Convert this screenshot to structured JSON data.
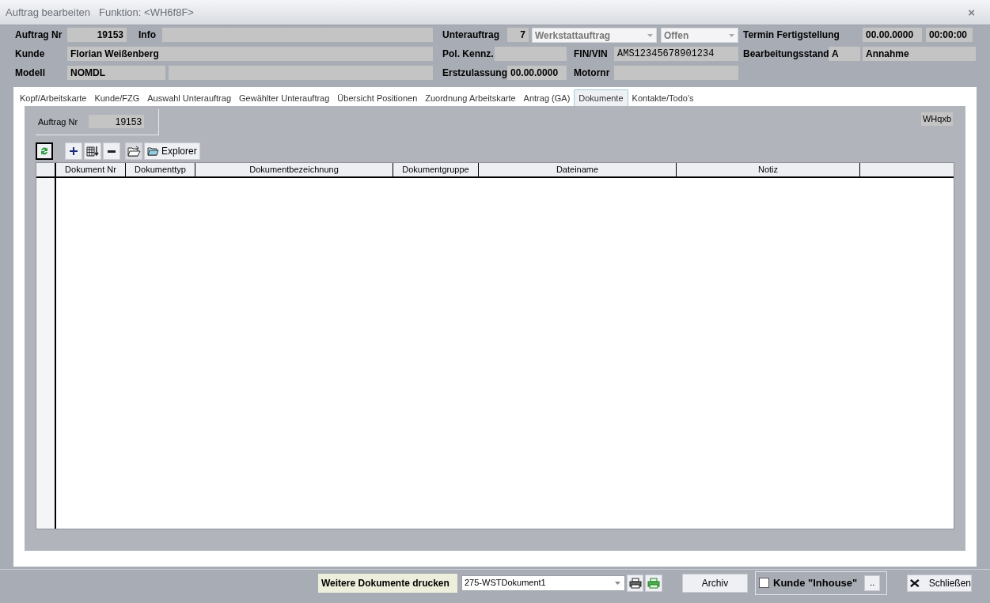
{
  "window": {
    "title": "Auftrag bearbeiten",
    "function": "Funktion: <WH6f8F>",
    "close": "×"
  },
  "header_fields": [
    {
      "label": "Auftrag Nr",
      "boxes": [
        {
          "kind": "number",
          "value": "19153"
        }
      ]
    },
    {
      "label": "Info",
      "boxes": [
        {
          "kind": "text"
        }
      ]
    },
    {
      "label": "Unterauftrag",
      "boxes": [
        {
          "kind": "number",
          "value": "7"
        },
        {
          "kind": "combo",
          "value": "Werkstattauftrag"
        },
        {
          "kind": "combo",
          "value": "Offen"
        }
      ]
    },
    {
      "label": "Termin Fertigstellung",
      "boxes": [
        {
          "kind": "text",
          "value": "00.00.0000"
        },
        {
          "kind": "text",
          "value": "00:00:00"
        }
      ]
    },
    {
      "label": "Kunde",
      "boxes": [
        {
          "kind": "text",
          "value": "Florian Weißenberg"
        }
      ]
    },
    {
      "label": "Pol. Kennz.",
      "boxes": [
        {
          "kind": "text"
        }
      ]
    },
    {
      "label": "FIN/VIN",
      "boxes": [
        {
          "kind": "code",
          "value": "AMS12345678901234"
        }
      ]
    },
    {
      "label": "Bearbeitungsstand",
      "boxes": [
        {
          "kind": "text",
          "value": "A"
        },
        {
          "kind": "text",
          "value": "Annahme"
        }
      ]
    },
    {
      "label": "Modell",
      "boxes": [
        {
          "kind": "text",
          "value": "NOMDL"
        },
        {
          "kind": "text"
        }
      ]
    },
    {
      "label": "Erstzulassung",
      "boxes": [
        {
          "kind": "text",
          "value": "00.00.0000"
        }
      ]
    },
    {
      "label": "Motornr",
      "boxes": [
        {
          "kind": "text"
        }
      ]
    }
  ],
  "tabs": [
    {
      "label": "Kopf/Arbeitskarte",
      "selected": false
    },
    {
      "label": "Kunde/FZG",
      "selected": false
    },
    {
      "label": "Auswahl Unterauftrag",
      "selected": false
    },
    {
      "label": "Gewählter Unterauftrag",
      "selected": false
    },
    {
      "label": "Übersicht Positionen",
      "selected": false
    },
    {
      "label": "Zuordnung Arbeitskarte",
      "selected": false
    },
    {
      "label": "Antrag (GA)",
      "selected": false
    },
    {
      "label": "Dokumente",
      "selected": true
    },
    {
      "label": "Kontakte/Todo's",
      "selected": false
    }
  ],
  "documents": {
    "order_label": "Auftrag Nr",
    "order_value": "19153",
    "code": "WHqxb",
    "explorer_button": "Explorer",
    "columns": [
      "Dokument Nr",
      "Dokumenttyp",
      "Dokumentbezeichnung",
      "Dokumentgruppe",
      "Dateiname",
      "Notiz"
    ]
  },
  "footer": {
    "print_label": "Weitere Dokumente drucken",
    "print_template": "275-WSTDokument1",
    "archive_button": "Archiv",
    "inhouse": {
      "label": "Kunde \"Inhouse\"",
      "checked": false
    },
    "more_button": "..",
    "close_button": "Schließen"
  }
}
